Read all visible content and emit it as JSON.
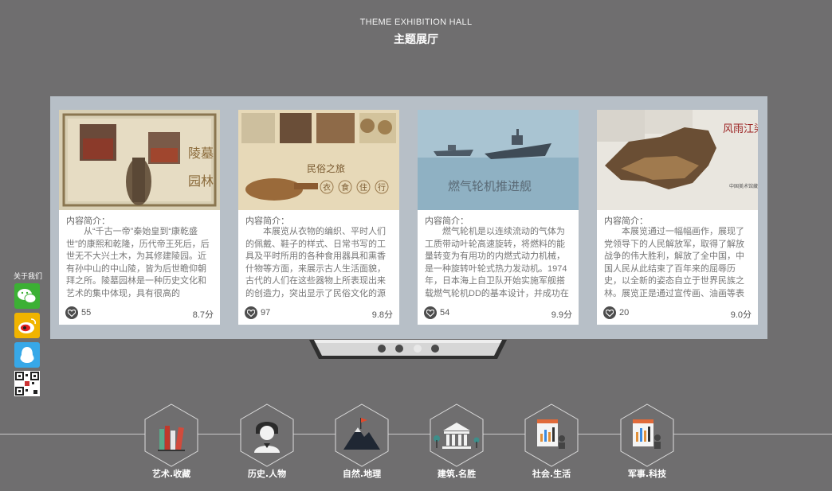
{
  "header": {
    "title_en": "THEME EXHIBITION HALL",
    "title_cn": "主题展厅"
  },
  "cards": [
    {
      "intro_label": "内容简介：",
      "description": "从“千古一帝”秦始皇到“康乾盛世”的康熙和乾隆，历代帝王死后，后世无不大兴土木，为其修建陵园。近有孙中山的中山陵，皆为后世瞻仰朝拜之所。陵墓园林是一种历史文化和艺术的集中体现，具有很高的",
      "likes": "55",
      "score": "8.7分",
      "thumb_text": [
        "陵墓",
        "园林"
      ]
    },
    {
      "intro_label": "内容简介：",
      "description": "本展览从衣物的编织、平时人们的佩戴、鞋子的样式、日常书写的工具及平时所用的各种食用器具和熏香什物等方面，来展示古人生活面貌，古代的人们在这些器物上所表现出来的创造力，突出显示了民俗文化的源",
      "likes": "97",
      "score": "9.8分",
      "thumb_text": [
        "民俗之旅",
        "衣",
        "食",
        "住",
        "行"
      ]
    },
    {
      "intro_label": "内容简介：",
      "description": "燃气轮机是以连续流动的气体为工质带动叶轮高速旋转，将燃料的能量转变为有用功的内燃式动力机械，是一种旋转叶轮式热力发动机。1974年，日本海上自卫队开始实施军舰搭载燃气轮机DD的基本设计，并成功在",
      "likes": "54",
      "score": "9.9分",
      "thumb_text": [
        "燃气轮机推进舰"
      ]
    },
    {
      "intro_label": "内容简介：",
      "description": "本展览通过一幅幅画作，展现了党领导下的人民解放军，取得了解放战争的伟大胜利，解放了全中国，中国人民从此结束了百年来的屈辱历史，以全新的姿态自立于世界民族之林。展览正是通过宣传画、油画等表",
      "likes": "20",
      "score": "9.0分",
      "thumb_text": [
        "风雨江染",
        "中国美术馆藏"
      ]
    }
  ],
  "pager": {
    "count": 4,
    "active_index": 2
  },
  "social": {
    "about_label": "关于我们",
    "items": [
      "wechat-icon",
      "weibo-icon",
      "qq-icon",
      "qrcode-icon"
    ],
    "colors": {
      "wechat": "#3cb034",
      "weibo": "#f0b400",
      "qq": "#37a8e8"
    }
  },
  "categories": [
    {
      "label": "艺术.收藏",
      "icon": "books-icon"
    },
    {
      "label": "历史.人物",
      "icon": "person-icon"
    },
    {
      "label": "自然.地理",
      "icon": "mountain-icon"
    },
    {
      "label": "建筑.名胜",
      "icon": "building-icon"
    },
    {
      "label": "社会.生活",
      "icon": "society-icon"
    },
    {
      "label": "军事.科技",
      "icon": "military-tech-icon"
    }
  ]
}
